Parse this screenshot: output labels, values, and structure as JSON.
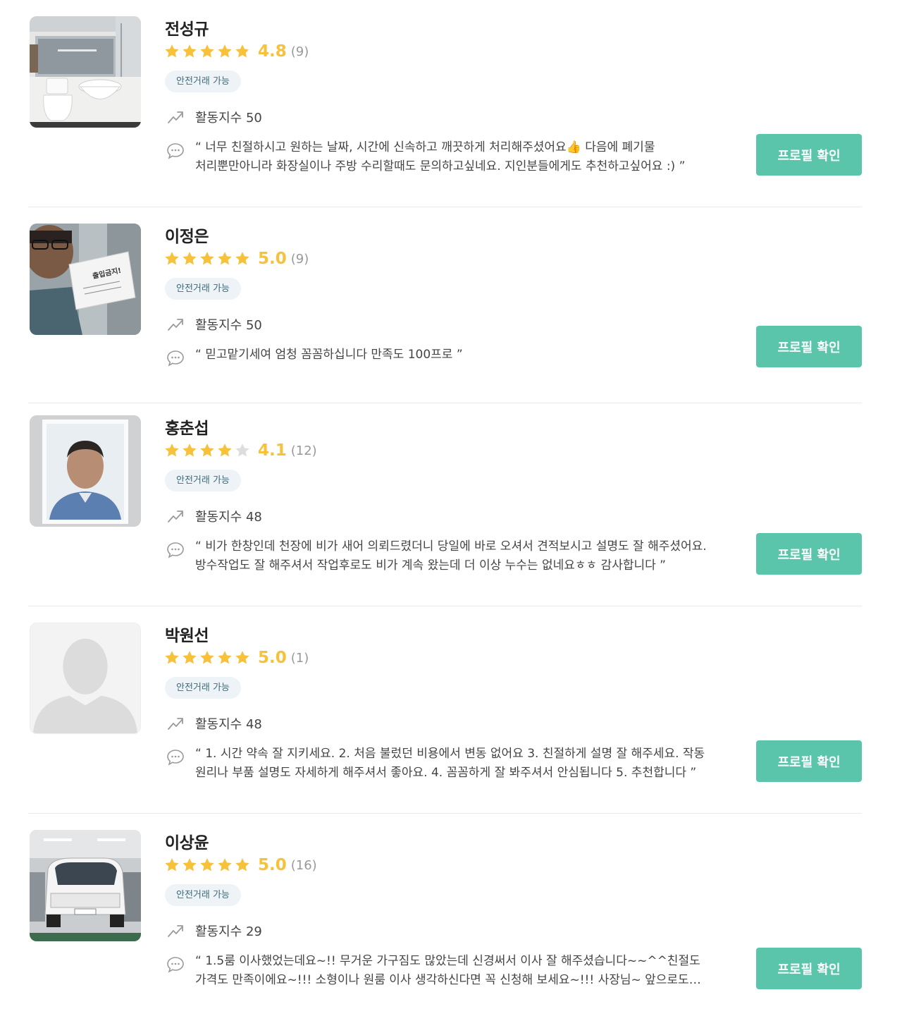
{
  "experts": [
    {
      "name": "전성규",
      "rating": 4.8,
      "rating_text": "4.8",
      "review_count": "(9)",
      "badge": "안전거래 가능",
      "activity": "활동지수 50",
      "review": "“ 너무 친절하시고 원하는 날짜, 시간에 신속하고 깨끗하게 처리해주셨어요👍 다음에 폐기물 처리뿐만아니라 화장실이나 주방 수리할때도 문의하고싶네요. 지인분들에게도 추천하고싶어요 :) ”",
      "button": "프로필 확인",
      "photo": "bathroom"
    },
    {
      "name": "이정은",
      "rating": 5.0,
      "rating_text": "5.0",
      "review_count": "(9)",
      "badge": "안전거래 가능",
      "activity": "활동지수 50",
      "review": "“ 믿고맡기세여 엄청 꼼꼼하십니다 만족도 100프로 ”",
      "button": "프로필 확인",
      "photo": "selfie",
      "photo_sign_text": "출입금지!"
    },
    {
      "name": "홍춘섭",
      "rating": 4.1,
      "rating_text": "4.1",
      "review_count": "(12)",
      "badge": "안전거래 가능",
      "activity": "활동지수 48",
      "review": "“ 비가 한창인데 천장에 비가 새어 의뢰드렸더니 당일에 바로 오셔서 견적보시고 설명도 잘 해주셨어요. 방수작업도 잘 해주셔서 작업후로도 비가 계속 왔는데 더 이상 누수는 없네요ㅎㅎ 감사합니다 ”",
      "button": "프로필 확인",
      "photo": "portrait"
    },
    {
      "name": "박원선",
      "rating": 5.0,
      "rating_text": "5.0",
      "review_count": "(1)",
      "badge": "안전거래 가능",
      "activity": "활동지수 48",
      "review": "“ 1. 시간 약속 잘 지키세요. 2. 처음 불렀던 비용에서 변동 없어요 3. 친절하게 설명 잘 해주세요. 작동 원리나 부품 설명도 자세하게 해주셔서 좋아요. 4. 꼼꼼하게 잘 봐주셔서 안심됩니다 5. 추천합니다 ”",
      "button": "프로필 확인",
      "photo": "default"
    },
    {
      "name": "이상윤",
      "rating": 5.0,
      "rating_text": "5.0",
      "review_count": "(16)",
      "badge": "안전거래 가능",
      "activity": "활동지수 29",
      "review": "“ 1.5룸 이사했었는데요~!! 무거운 가구짐도 많았는데 신경써서 이사 잘 해주셨습니다~~^^친절도 가격도 만족이에요~!!! 소형이나 원룸 이사 생각하신다면 꼭 신청해 보세요~!!! 사장님~ 앞으로도 번창하세요 ”",
      "button": "프로필 확인",
      "photo": "truck"
    }
  ],
  "colors": {
    "star_filled": "#f7c23a",
    "star_empty": "#dddddd",
    "button_bg": "#5ac5ab",
    "badge_bg": "#edf3f6",
    "badge_text": "#3c6b7a"
  },
  "icons": {
    "activity": "trending-up-icon",
    "review": "speech-bubble-icon",
    "star": "star-icon"
  }
}
